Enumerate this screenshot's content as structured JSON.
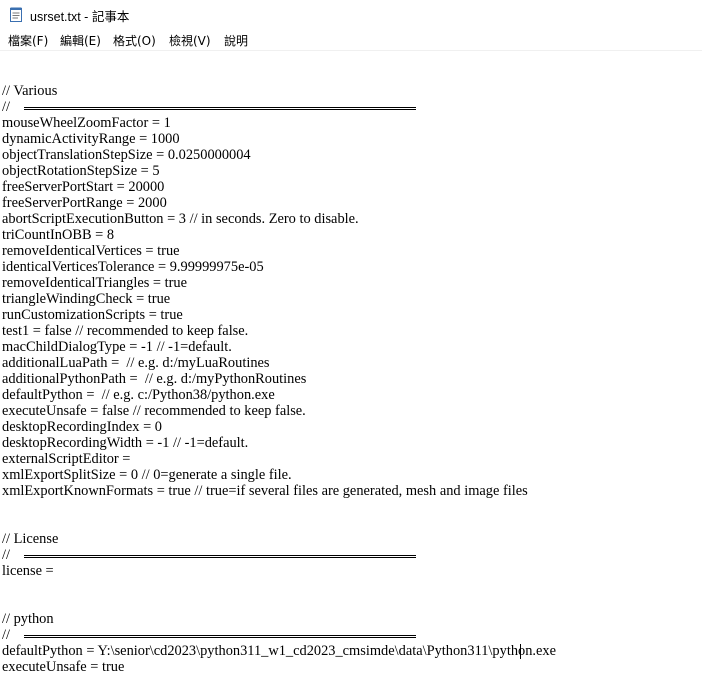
{
  "window": {
    "title": "usrset.txt - 記事本",
    "app_icon": "notepad-icon"
  },
  "menu": [
    "檔案(F)",
    "編輯(E)",
    "格式(O)",
    "檢視(V)",
    "說明"
  ],
  "editor": {
    "lines": [
      "// Various",
      "// ",
      "mouseWheelZoomFactor = 1",
      "dynamicActivityRange = 1000",
      "objectTranslationStepSize = 0.0250000004",
      "objectRotationStepSize = 5",
      "freeServerPortStart = 20000",
      "freeServerPortRange = 2000",
      "abortScriptExecutionButton = 3 // in seconds. Zero to disable.",
      "triCountInOBB = 8",
      "removeIdenticalVertices = true",
      "identicalVerticesTolerance = 9.99999975e-05",
      "removeIdenticalTriangles = true",
      "triangleWindingCheck = true",
      "runCustomizationScripts = true",
      "test1 = false // recommended to keep false.",
      "macChildDialogType = -1 // -1=default.",
      "additionalLuaPath =  // e.g. d:/myLuaRoutines",
      "additionalPythonPath =  // e.g. d:/myPythonRoutines",
      "defaultPython =  // e.g. c:/Python38/python.exe",
      "executeUnsafe = false // recommended to keep false.",
      "desktopRecordingIndex = 0",
      "desktopRecordingWidth = -1 // -1=default.",
      "externalScriptEditor =",
      "xmlExportSplitSize = 0 // 0=generate a single file.",
      "xmlExportKnownFormats = true // true=if several files are generated, mesh and image files",
      "",
      "",
      "// License",
      "// ",
      "license =",
      "",
      "",
      "// python",
      "// ",
      "defaultPython = Y:\\senior\\cd2023\\python311_w1_cd2023_cmsimde\\data\\Python311\\python.exe",
      "executeUnsafe = true"
    ]
  }
}
